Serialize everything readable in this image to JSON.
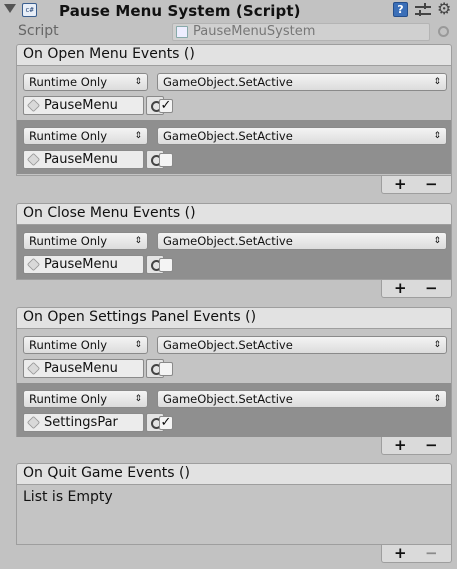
{
  "component": {
    "title": "Pause Menu System (Script)",
    "icon": "script-component-icon",
    "help_icon": "?",
    "script_label": "Script",
    "script_value": "PauseMenuSystem"
  },
  "events": [
    {
      "title": "On Open Menu Events ()",
      "entries": [
        {
          "mode": "Runtime Only",
          "function": "GameObject.SetActive",
          "target": "PauseMenu",
          "checked": true,
          "selected": false
        },
        {
          "mode": "Runtime Only",
          "function": "GameObject.SetActive",
          "target": "PauseMenu",
          "checked": false,
          "selected": true
        }
      ],
      "add": "+",
      "remove": "−"
    },
    {
      "title": "On Close Menu Events ()",
      "entries": [
        {
          "mode": "Runtime Only",
          "function": "GameObject.SetActive",
          "target": "PauseMenu",
          "checked": false,
          "selected": true
        }
      ],
      "add": "+",
      "remove": "−"
    },
    {
      "title": "On Open Settings Panel Events ()",
      "entries": [
        {
          "mode": "Runtime Only",
          "function": "GameObject.SetActive",
          "target": "PauseMenu",
          "checked": false,
          "selected": false
        },
        {
          "mode": "Runtime Only",
          "function": "GameObject.SetActive",
          "target": "SettingsPar",
          "checked": true,
          "selected": true
        }
      ],
      "add": "+",
      "remove": "−"
    },
    {
      "title": "On Quit Game Events ()",
      "empty_text": "List is Empty",
      "add": "+",
      "remove": "−"
    }
  ]
}
